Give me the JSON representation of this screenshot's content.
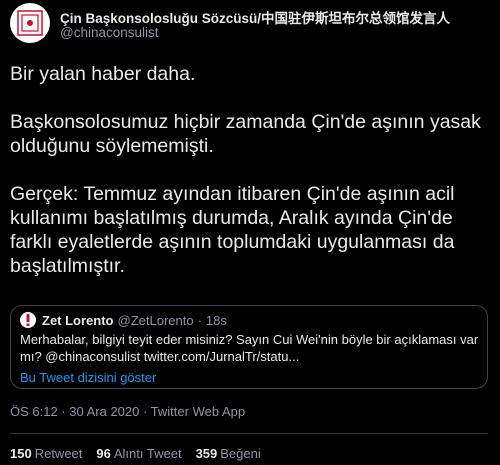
{
  "author": {
    "name": "Çin Başkonsolosluğu Sözcüsü/中国驻伊斯坦布尔总领馆发言人",
    "handle": "@chinaconsulist"
  },
  "tweet": {
    "paragraphs": [
      "Bir yalan haber daha.",
      "Başkonsolosumuz hiçbir zamanda Çin'de aşının yasak olduğunu söylememişti.",
      "Gerçek: Temmuz ayından itibaren Çin'de aşının acil kullanımı başlatılmış durumda, Aralık ayında Çin'de farklı eyaletlerde aşının toplumdaki uygulanması da başlatılmıştır."
    ]
  },
  "quote": {
    "name": "Zet Lorento",
    "handle": "@ZetLorento",
    "separator": "·",
    "time": "18s",
    "text": "Merhabalar, bilgiyi teyit eder misiniz? Sayın Cui Wei'nin böyle bir açıklaması var mı? @chinaconsulist twitter.com/JurnalTr/statu...",
    "thread_link": "Bu Tweet dizisini göster"
  },
  "meta": {
    "timestamp": "ÖS 6:12 · 30 Ara 2020 · Twitter Web App"
  },
  "stats": {
    "retweets": "150",
    "retweets_label": "Retweet",
    "quotes": "96",
    "quotes_label": "Alıntı Tweet",
    "likes": "359",
    "likes_label": "Beğeni"
  },
  "colors": {
    "background": "#000000",
    "link": "#1d9bf0",
    "muted": "#8b98a5"
  },
  "icons": {
    "author_avatar": "consulate-emblem-icon",
    "quote_avatar": "exclamation-icon"
  }
}
